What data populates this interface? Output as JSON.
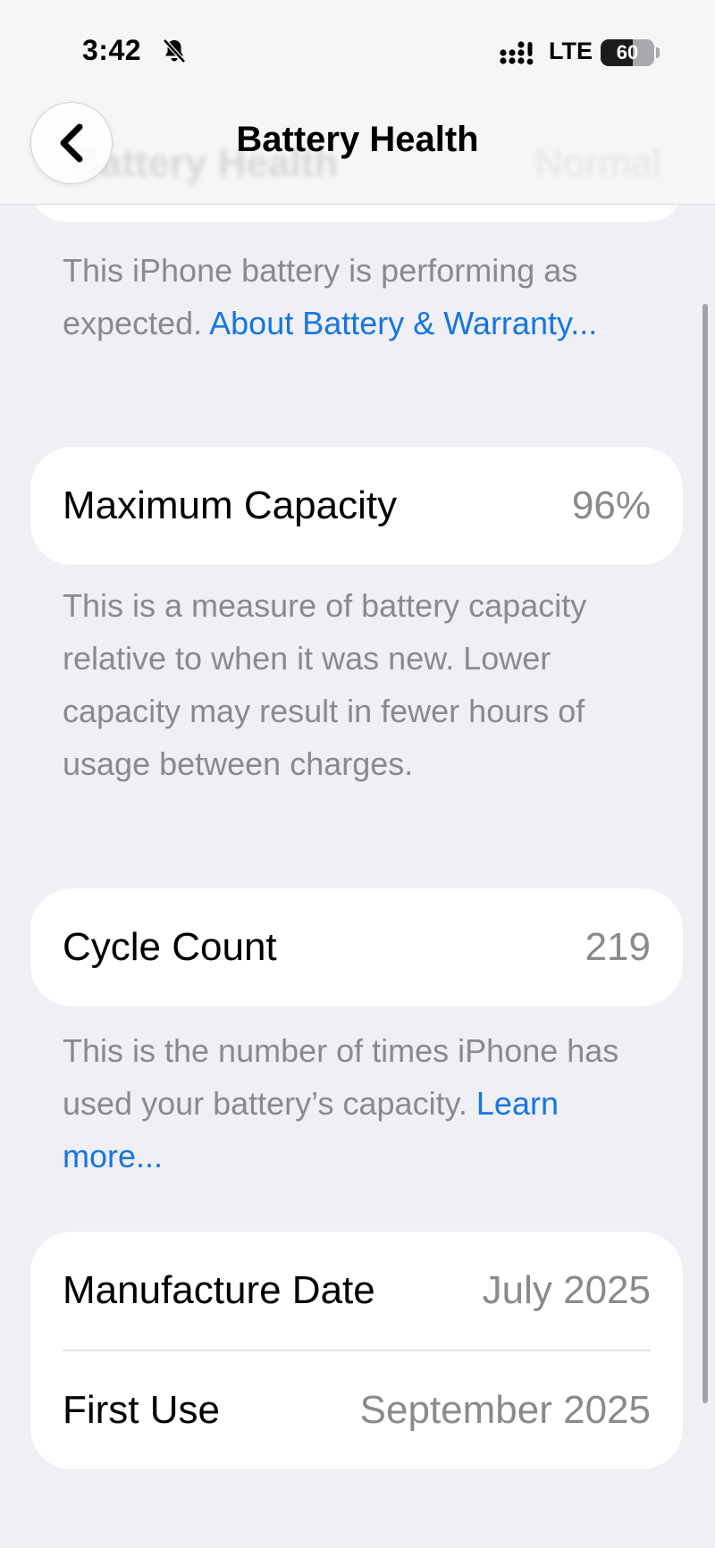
{
  "status_bar": {
    "time": "3:42",
    "network": "LTE",
    "battery_level": "60",
    "battery_fraction": 0.6
  },
  "nav": {
    "title": "Battery Health"
  },
  "ghost_row": {
    "label": "Battery Health",
    "value": "Normal"
  },
  "health_footer": {
    "text": "This iPhone battery is performing as expected. ",
    "link": "About Battery & Warranty..."
  },
  "max_capacity": {
    "label": "Maximum Capacity",
    "value": "96%",
    "footer": "This is a measure of battery capacity relative to when it was new. Lower capacity may result in fewer hours of usage between charges."
  },
  "cycle_count": {
    "label": "Cycle Count",
    "value": "219",
    "footer": "This is the number of times iPhone has used your battery’s capacity. ",
    "link": "Learn more..."
  },
  "dates": {
    "manufacture_label": "Manufacture Date",
    "manufacture_value": "July 2025",
    "first_use_label": "First Use",
    "first_use_value": "September 2025"
  },
  "colors": {
    "background": "#efeff4",
    "link": "#1676e0",
    "secondary_text": "#8a8a8e"
  },
  "icons": [
    "bell-slash-icon",
    "cellular-signal-icon",
    "battery-icon",
    "chevron-left-icon"
  ]
}
